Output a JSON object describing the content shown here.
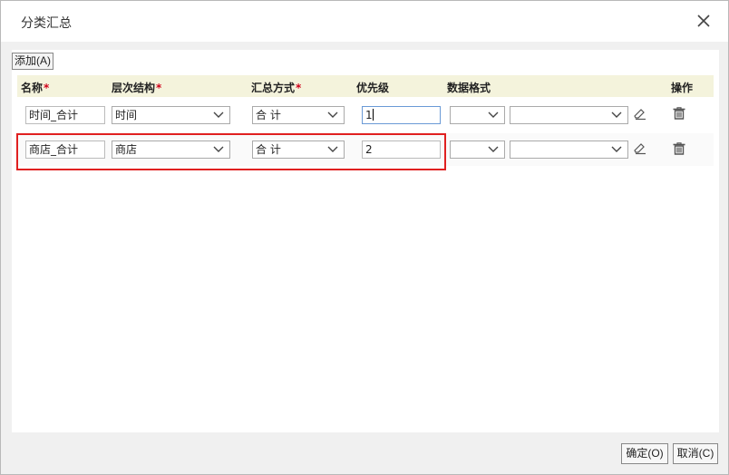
{
  "dialog": {
    "title": "分类汇总",
    "add_label": "添加(A)",
    "ok_label": "确定(O)",
    "cancel_label": "取消(C)"
  },
  "columns": {
    "name": "名称",
    "hierarchy": "层次结构",
    "method": "汇总方式",
    "priority": "优先级",
    "format": "数据格式",
    "action": "操作",
    "required_mark": "*"
  },
  "rows": [
    {
      "name": "时间_合计",
      "hierarchy": "时间",
      "method": "合 计",
      "priority": "1",
      "format_type": "",
      "format_value": ""
    },
    {
      "name": "商店_合计",
      "hierarchy": "商店",
      "method": "合 计",
      "priority": "2",
      "format_type": "",
      "format_value": ""
    }
  ],
  "colors": {
    "header_bg": "#f4f3dc",
    "highlight": "#e02020",
    "required": "#d0021b"
  },
  "icons": [
    "close-icon",
    "chevron-down-icon",
    "eraser-icon",
    "trash-icon"
  ]
}
